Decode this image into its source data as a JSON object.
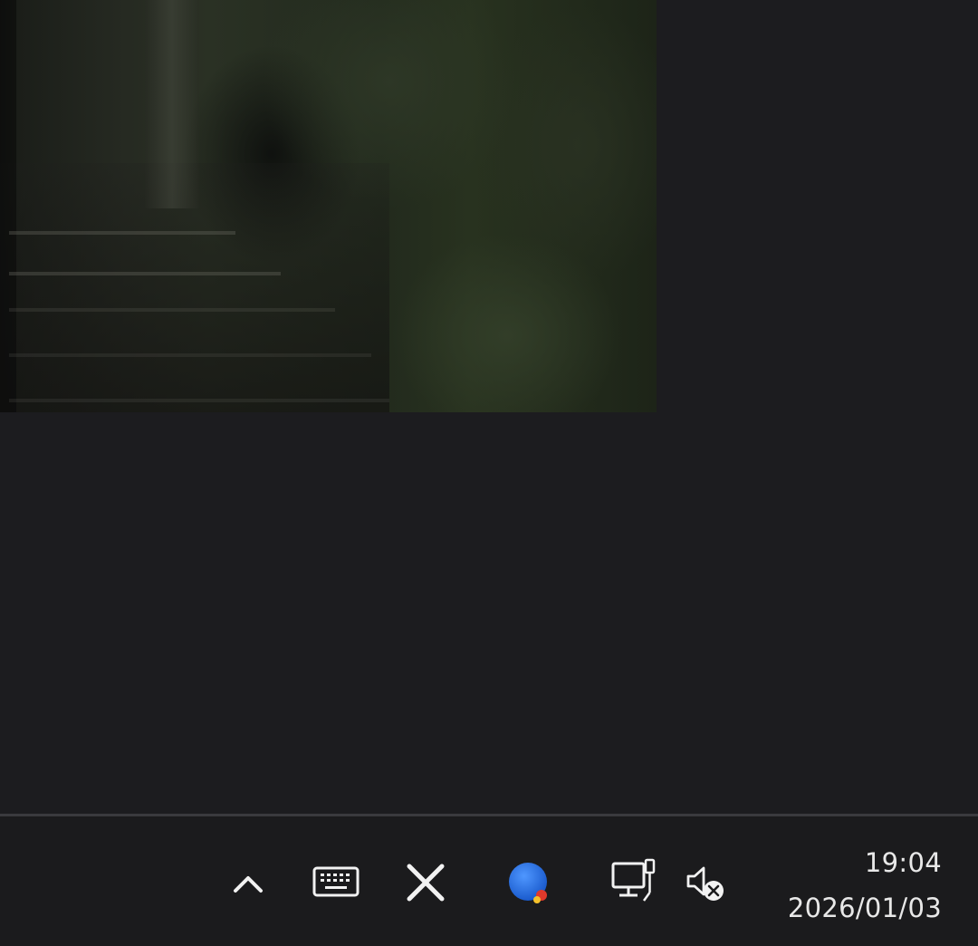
{
  "taskbar": {
    "clock": {
      "time": "19:04",
      "date": "2026/01/03"
    },
    "tray_icons": [
      "chevron-up-icon",
      "touch-keyboard-icon",
      "close-x-icon",
      "app-blue-circle-icon",
      "network-wired-icon",
      "volume-muted-icon"
    ]
  },
  "colors": {
    "desktop_background": "#1c1c1f",
    "taskbar_background": "#1b1b1d",
    "app_icon_blue": "#1f6fe0",
    "icon_foreground": "#f2f2f2"
  }
}
